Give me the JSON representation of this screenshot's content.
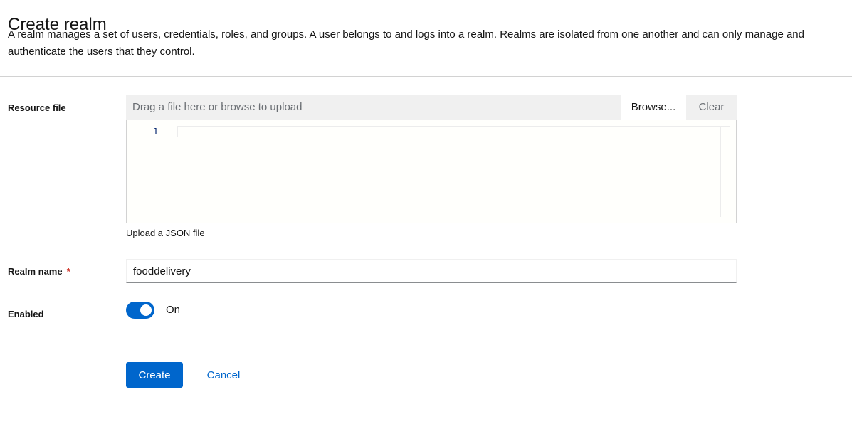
{
  "page": {
    "title": "Create realm",
    "description": "A realm manages a set of users, credentials, roles, and groups. A user belongs to and logs into a realm. Realms are isolated from one another and can only manage and authenticate the users that they control."
  },
  "resource_file": {
    "label": "Resource file",
    "placeholder": "Drag a file here or browse to upload",
    "browse_label": "Browse...",
    "clear_label": "Clear",
    "editor_line_number": "1",
    "helper_text": "Upload a JSON file"
  },
  "realm_name": {
    "label": "Realm name",
    "required_marker": "*",
    "value": "fooddelivery"
  },
  "enabled": {
    "label": "Enabled",
    "state_label": "On",
    "checked": true
  },
  "actions": {
    "create_label": "Create",
    "cancel_label": "Cancel"
  },
  "colors": {
    "primary": "#0066cc",
    "required": "#c9190b",
    "upload_bar": "#f0f0f0"
  }
}
